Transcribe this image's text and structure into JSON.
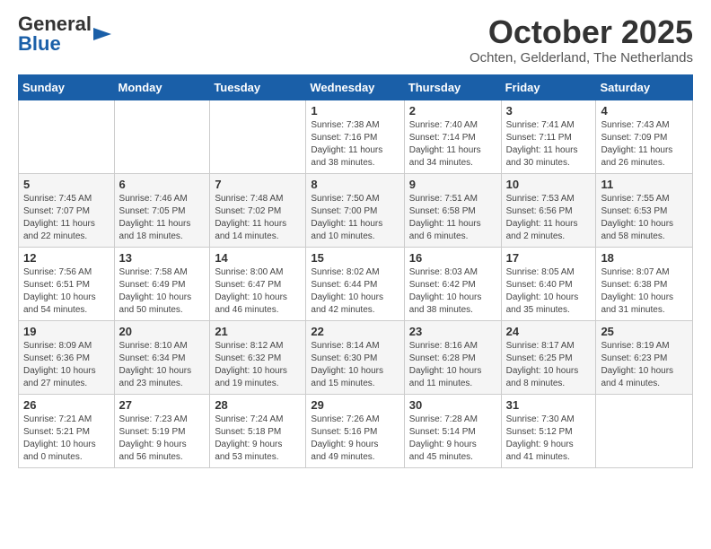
{
  "header": {
    "logo_general": "General",
    "logo_blue": "Blue",
    "month_year": "October 2025",
    "location": "Ochten, Gelderland, The Netherlands"
  },
  "weekdays": [
    "Sunday",
    "Monday",
    "Tuesday",
    "Wednesday",
    "Thursday",
    "Friday",
    "Saturday"
  ],
  "weeks": [
    [
      {
        "num": "",
        "info": ""
      },
      {
        "num": "",
        "info": ""
      },
      {
        "num": "",
        "info": ""
      },
      {
        "num": "1",
        "info": "Sunrise: 7:38 AM\nSunset: 7:16 PM\nDaylight: 11 hours\nand 38 minutes."
      },
      {
        "num": "2",
        "info": "Sunrise: 7:40 AM\nSunset: 7:14 PM\nDaylight: 11 hours\nand 34 minutes."
      },
      {
        "num": "3",
        "info": "Sunrise: 7:41 AM\nSunset: 7:11 PM\nDaylight: 11 hours\nand 30 minutes."
      },
      {
        "num": "4",
        "info": "Sunrise: 7:43 AM\nSunset: 7:09 PM\nDaylight: 11 hours\nand 26 minutes."
      }
    ],
    [
      {
        "num": "5",
        "info": "Sunrise: 7:45 AM\nSunset: 7:07 PM\nDaylight: 11 hours\nand 22 minutes."
      },
      {
        "num": "6",
        "info": "Sunrise: 7:46 AM\nSunset: 7:05 PM\nDaylight: 11 hours\nand 18 minutes."
      },
      {
        "num": "7",
        "info": "Sunrise: 7:48 AM\nSunset: 7:02 PM\nDaylight: 11 hours\nand 14 minutes."
      },
      {
        "num": "8",
        "info": "Sunrise: 7:50 AM\nSunset: 7:00 PM\nDaylight: 11 hours\nand 10 minutes."
      },
      {
        "num": "9",
        "info": "Sunrise: 7:51 AM\nSunset: 6:58 PM\nDaylight: 11 hours\nand 6 minutes."
      },
      {
        "num": "10",
        "info": "Sunrise: 7:53 AM\nSunset: 6:56 PM\nDaylight: 11 hours\nand 2 minutes."
      },
      {
        "num": "11",
        "info": "Sunrise: 7:55 AM\nSunset: 6:53 PM\nDaylight: 10 hours\nand 58 minutes."
      }
    ],
    [
      {
        "num": "12",
        "info": "Sunrise: 7:56 AM\nSunset: 6:51 PM\nDaylight: 10 hours\nand 54 minutes."
      },
      {
        "num": "13",
        "info": "Sunrise: 7:58 AM\nSunset: 6:49 PM\nDaylight: 10 hours\nand 50 minutes."
      },
      {
        "num": "14",
        "info": "Sunrise: 8:00 AM\nSunset: 6:47 PM\nDaylight: 10 hours\nand 46 minutes."
      },
      {
        "num": "15",
        "info": "Sunrise: 8:02 AM\nSunset: 6:44 PM\nDaylight: 10 hours\nand 42 minutes."
      },
      {
        "num": "16",
        "info": "Sunrise: 8:03 AM\nSunset: 6:42 PM\nDaylight: 10 hours\nand 38 minutes."
      },
      {
        "num": "17",
        "info": "Sunrise: 8:05 AM\nSunset: 6:40 PM\nDaylight: 10 hours\nand 35 minutes."
      },
      {
        "num": "18",
        "info": "Sunrise: 8:07 AM\nSunset: 6:38 PM\nDaylight: 10 hours\nand 31 minutes."
      }
    ],
    [
      {
        "num": "19",
        "info": "Sunrise: 8:09 AM\nSunset: 6:36 PM\nDaylight: 10 hours\nand 27 minutes."
      },
      {
        "num": "20",
        "info": "Sunrise: 8:10 AM\nSunset: 6:34 PM\nDaylight: 10 hours\nand 23 minutes."
      },
      {
        "num": "21",
        "info": "Sunrise: 8:12 AM\nSunset: 6:32 PM\nDaylight: 10 hours\nand 19 minutes."
      },
      {
        "num": "22",
        "info": "Sunrise: 8:14 AM\nSunset: 6:30 PM\nDaylight: 10 hours\nand 15 minutes."
      },
      {
        "num": "23",
        "info": "Sunrise: 8:16 AM\nSunset: 6:28 PM\nDaylight: 10 hours\nand 11 minutes."
      },
      {
        "num": "24",
        "info": "Sunrise: 8:17 AM\nSunset: 6:25 PM\nDaylight: 10 hours\nand 8 minutes."
      },
      {
        "num": "25",
        "info": "Sunrise: 8:19 AM\nSunset: 6:23 PM\nDaylight: 10 hours\nand 4 minutes."
      }
    ],
    [
      {
        "num": "26",
        "info": "Sunrise: 7:21 AM\nSunset: 5:21 PM\nDaylight: 10 hours\nand 0 minutes."
      },
      {
        "num": "27",
        "info": "Sunrise: 7:23 AM\nSunset: 5:19 PM\nDaylight: 9 hours\nand 56 minutes."
      },
      {
        "num": "28",
        "info": "Sunrise: 7:24 AM\nSunset: 5:18 PM\nDaylight: 9 hours\nand 53 minutes."
      },
      {
        "num": "29",
        "info": "Sunrise: 7:26 AM\nSunset: 5:16 PM\nDaylight: 9 hours\nand 49 minutes."
      },
      {
        "num": "30",
        "info": "Sunrise: 7:28 AM\nSunset: 5:14 PM\nDaylight: 9 hours\nand 45 minutes."
      },
      {
        "num": "31",
        "info": "Sunrise: 7:30 AM\nSunset: 5:12 PM\nDaylight: 9 hours\nand 41 minutes."
      },
      {
        "num": "",
        "info": ""
      }
    ]
  ]
}
